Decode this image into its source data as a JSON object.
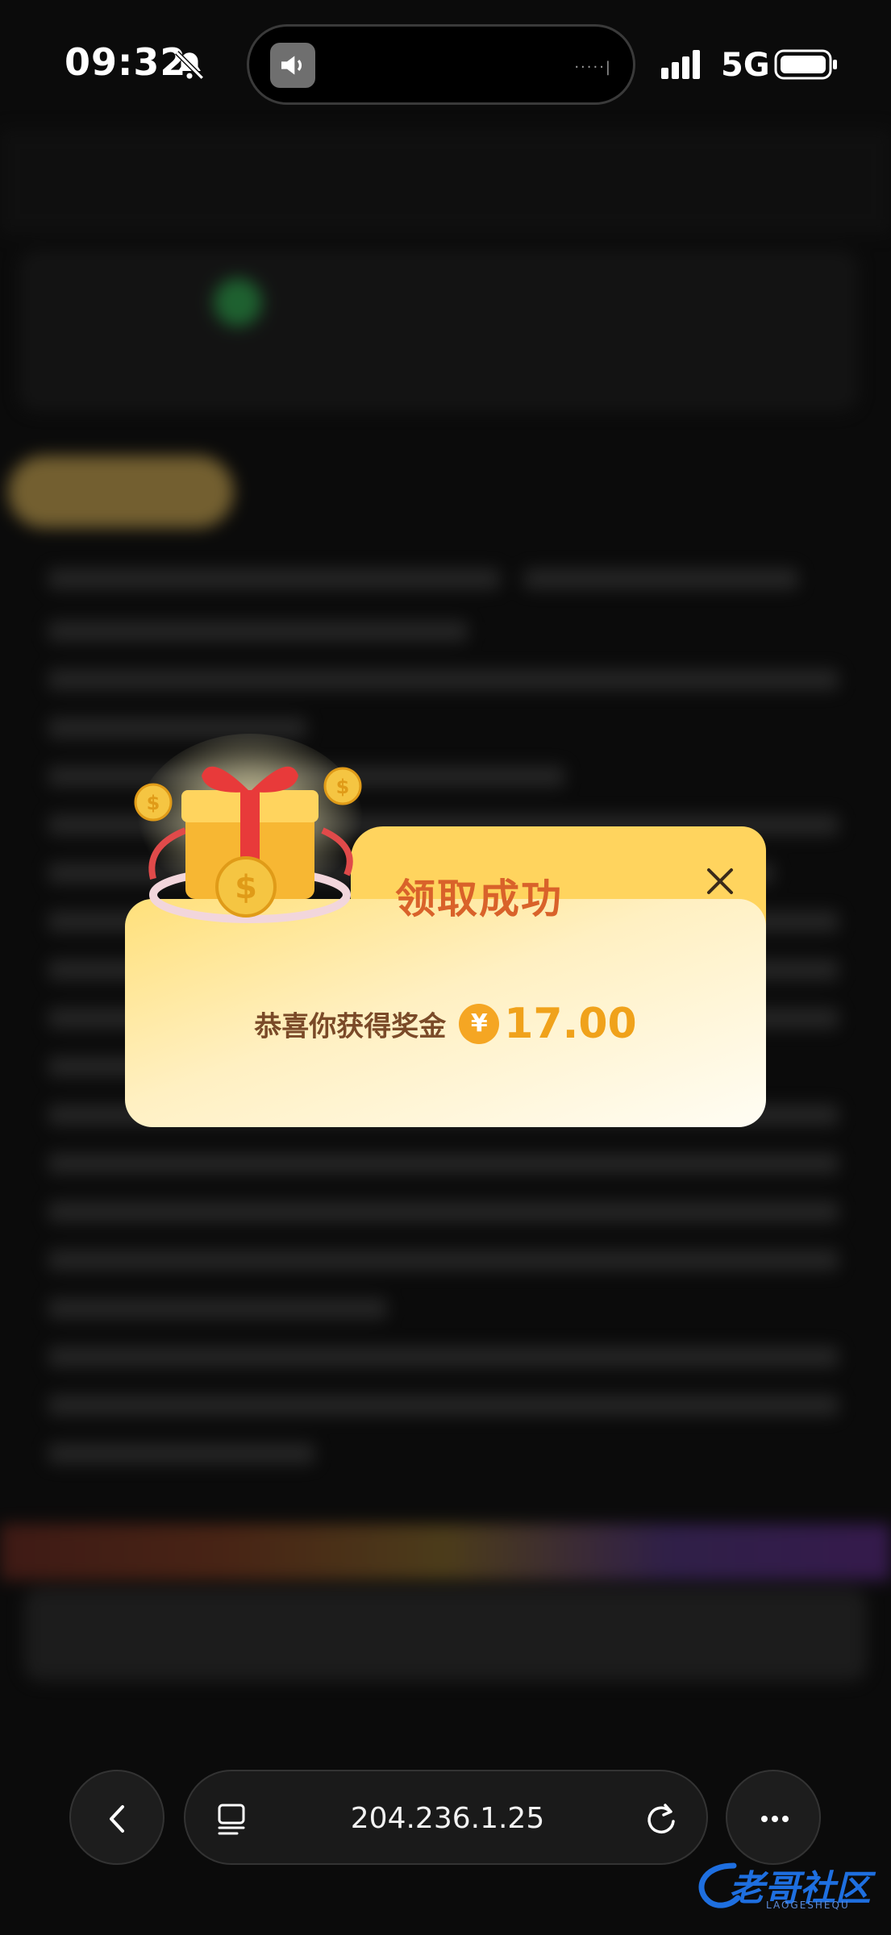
{
  "status_bar": {
    "time": "09:32",
    "network": "5G"
  },
  "dialog": {
    "title": "领取成功",
    "message": "恭喜你获得奖金",
    "currency_symbol": "¥",
    "amount": "17.00"
  },
  "browser": {
    "url": "204.236.1.25"
  },
  "watermark": {
    "text": "老哥社区",
    "subtext": "LAOGESHEQU"
  },
  "colors": {
    "dialog_title": "#d9622a",
    "amount": "#f0a21b",
    "coin": "#f5a623",
    "background": "#0b0b0b"
  },
  "icons": [
    "bell-muted-icon",
    "speaker-icon",
    "signal-icon",
    "battery-icon",
    "close-icon",
    "gift-icon",
    "back-icon",
    "tabs-icon",
    "reload-icon",
    "more-icon"
  ]
}
